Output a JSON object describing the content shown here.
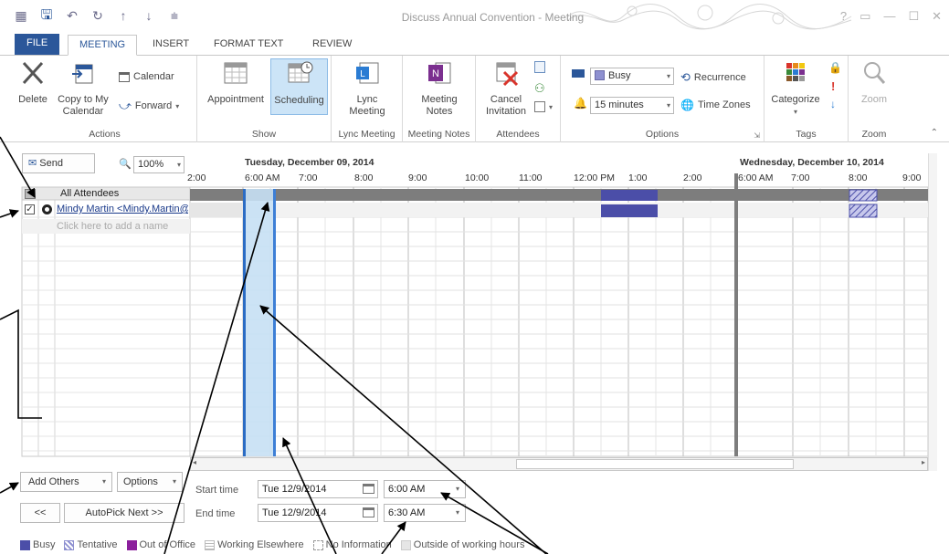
{
  "window": {
    "title": "Discuss Annual Convention - Meeting",
    "controls": [
      "?",
      "▭",
      "—",
      "☐",
      "✕"
    ]
  },
  "tabs": [
    "FILE",
    "MEETING",
    "INSERT",
    "FORMAT TEXT",
    "REVIEW"
  ],
  "ribbon": {
    "actions": {
      "label": "Actions",
      "delete": "Delete",
      "copy_line1": "Copy to My",
      "copy_line2": "Calendar",
      "calendar": "Calendar",
      "forward": "Forward"
    },
    "show": {
      "label": "Show",
      "appointment": "Appointment",
      "scheduling": "Scheduling"
    },
    "lync": {
      "label": "Lync Meeting",
      "line1": "Lync",
      "line2": "Meeting"
    },
    "notes": {
      "label": "Meeting Notes",
      "line1": "Meeting",
      "line2": "Notes"
    },
    "attendees": {
      "label": "Attendees",
      "cancel_line1": "Cancel",
      "cancel_line2": "Invitation"
    },
    "options": {
      "label": "Options",
      "show_as": "Busy",
      "reminder": "15 minutes",
      "recurrence": "Recurrence",
      "time_zones": "Time Zones"
    },
    "tags": {
      "label": "Tags",
      "categorize": "Categorize"
    },
    "zoom": {
      "label": "Zoom",
      "zoom": "Zoom"
    }
  },
  "scheduler": {
    "send": "Send",
    "zoom_value": "100%",
    "all_attendees": "All Attendees",
    "attendee": "Mindy Martin <Mindy.Martin@",
    "add_placeholder": "Click here to add a name",
    "day1": "Tuesday, December 09, 2014",
    "day2": "Wednesday, December 10, 2014",
    "day1_times": [
      "2:00",
      "6:00 AM",
      "7:00",
      "8:00",
      "9:00",
      "10:00",
      "11:00",
      "12:00 PM",
      "1:00",
      "2:00"
    ],
    "day2_times": [
      "6:00 AM",
      "7:00",
      "8:00",
      "9:00"
    ],
    "add_others": "Add Others",
    "options": "Options",
    "prev": "<<",
    "autopick": "AutoPick Next >>",
    "start_label": "Start time",
    "end_label": "End time",
    "start_date": "Tue 12/9/2014",
    "start_time": "6:00 AM",
    "end_date": "Tue 12/9/2014",
    "end_time": "6:30 AM"
  },
  "legend": [
    {
      "label": "Busy",
      "color": "#4b4ea8"
    },
    {
      "label": "Tentative",
      "color": "#8e90d0"
    },
    {
      "label": "Out of Office",
      "color": "#8b1f9c"
    },
    {
      "label": "Working Elsewhere",
      "color": "#c9c9c9"
    },
    {
      "label": "No Information",
      "color": "#ffffff"
    },
    {
      "label": "Outside of working hours",
      "color": "#e6e6e6"
    }
  ],
  "colors": {
    "accent": "#2b579a",
    "selection": "#c7e0f4",
    "selection_edge": "#2b6cc4",
    "busy": "#4b4ea8",
    "grid_header": "#7d7d7d"
  }
}
